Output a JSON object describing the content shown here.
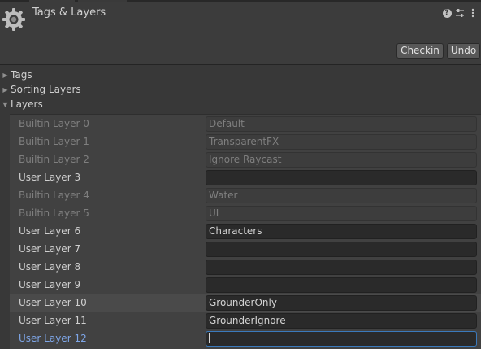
{
  "window": {
    "title": "Tags & Layers",
    "tools": [
      "help-icon",
      "preset-icon",
      "menu-icon"
    ]
  },
  "toolbar": {
    "checkin_label": "Checkin",
    "undo_label": "Undo"
  },
  "sections": {
    "tags": "Tags",
    "sorting_layers": "Sorting Layers",
    "layers": "Layers"
  },
  "layers": [
    {
      "label": "Builtin Layer 0",
      "value": "Default",
      "kind": "builtin"
    },
    {
      "label": "Builtin Layer 1",
      "value": "TransparentFX",
      "kind": "builtin"
    },
    {
      "label": "Builtin Layer 2",
      "value": "Ignore Raycast",
      "kind": "builtin"
    },
    {
      "label": "User Layer 3",
      "value": "",
      "kind": "user"
    },
    {
      "label": "Builtin Layer 4",
      "value": "Water",
      "kind": "builtin"
    },
    {
      "label": "Builtin Layer 5",
      "value": "UI",
      "kind": "builtin"
    },
    {
      "label": "User Layer 6",
      "value": "Characters",
      "kind": "user"
    },
    {
      "label": "User Layer 7",
      "value": "",
      "kind": "user"
    },
    {
      "label": "User Layer 8",
      "value": "",
      "kind": "user"
    },
    {
      "label": "User Layer 9",
      "value": "",
      "kind": "user"
    },
    {
      "label": "User Layer 10",
      "value": "GrounderOnly",
      "kind": "user"
    },
    {
      "label": "User Layer 11",
      "value": "GrounderIgnore",
      "kind": "user"
    },
    {
      "label": "User Layer 12",
      "value": "",
      "kind": "user"
    }
  ],
  "colors": {
    "background": "#383838",
    "active_label": "#7ea6e8",
    "focus_border": "#3a79bb"
  }
}
